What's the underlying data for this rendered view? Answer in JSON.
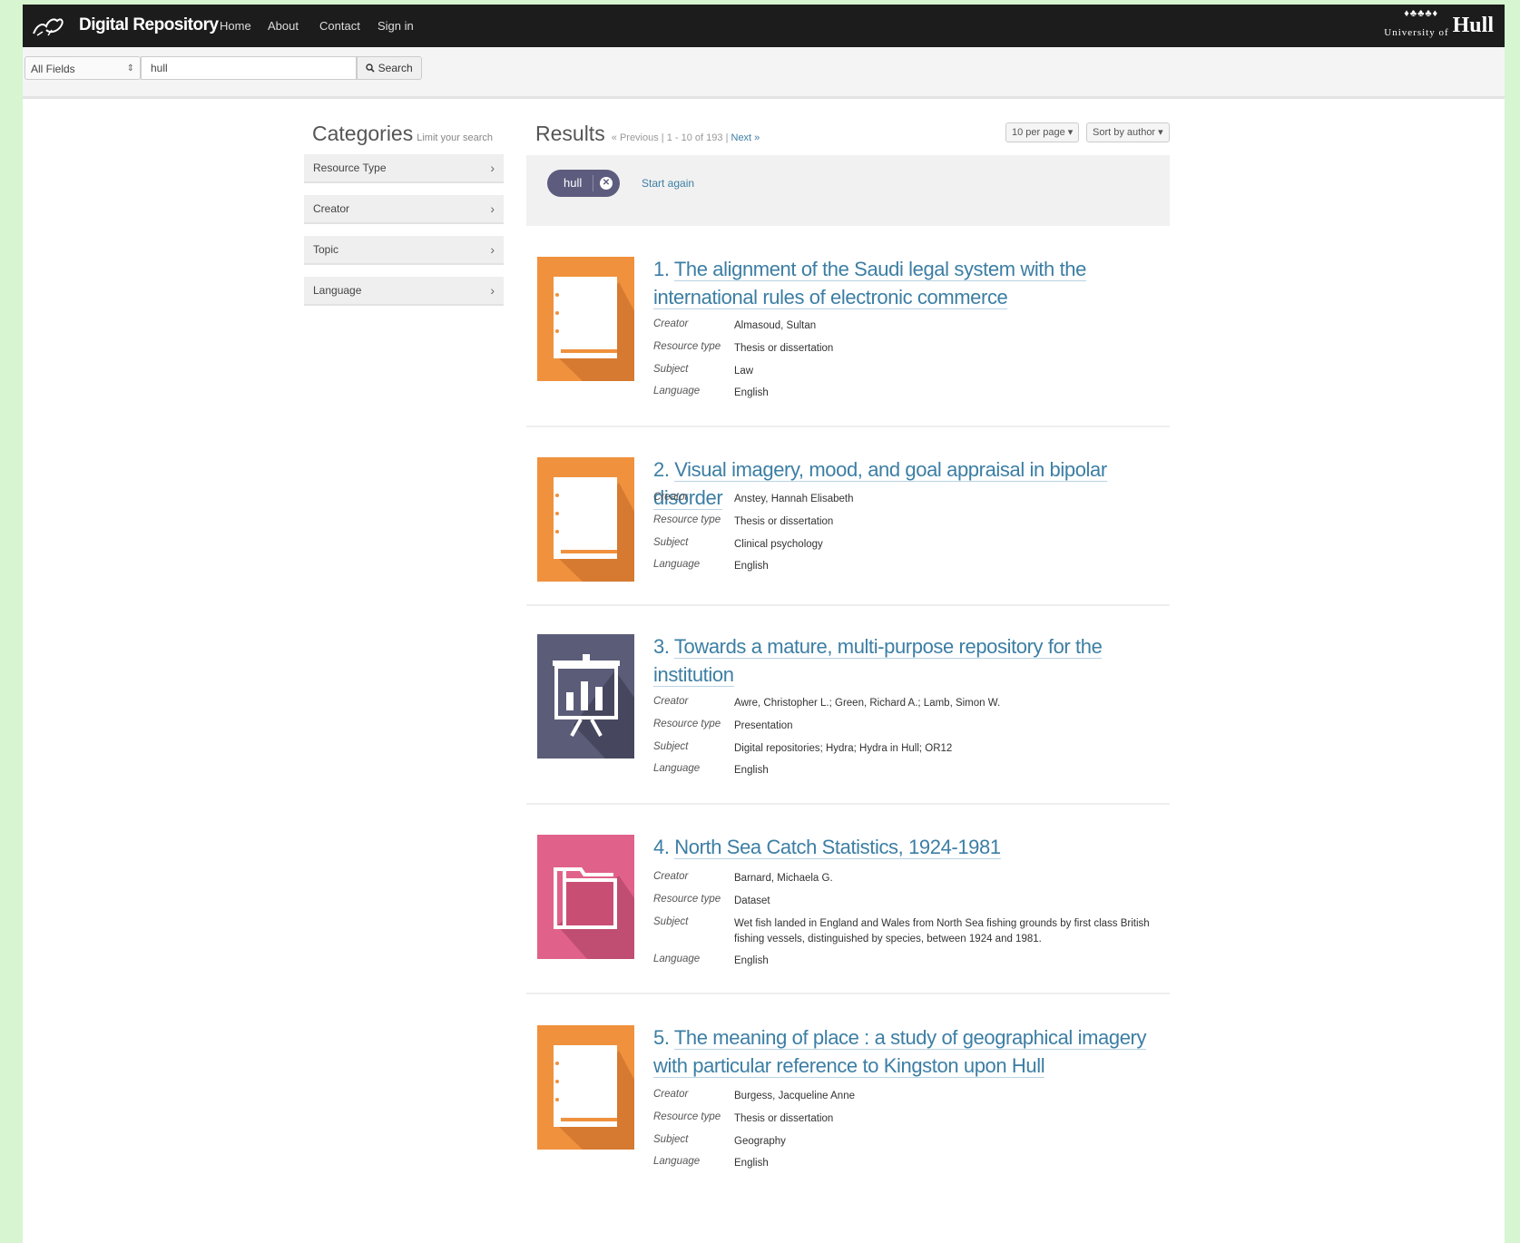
{
  "topbar": {
    "brand_title": "Digital Repository",
    "nav": [
      "Home",
      "About",
      "Contact",
      "Sign in"
    ],
    "university_small": "University of",
    "university_big": "Hull",
    "background_color": "#1c1c1c"
  },
  "search": {
    "field_selected": "All Fields",
    "query": "hull",
    "button_label": "Search",
    "search_icon": "magnifier-icon"
  },
  "sidebar": {
    "heading": "Categories",
    "subheading": "Limit your search",
    "facets": [
      "Resource Type",
      "Creator",
      "Topic",
      "Language"
    ]
  },
  "results_header": {
    "heading": "Results",
    "previous": "« Previous",
    "range": "1 - 10 of 193",
    "next": "Next »",
    "per_page": "10 per page",
    "sort": "Sort by author",
    "filter_value": "hull",
    "start_again": "Start again"
  },
  "field_labels": {
    "creator": "Creator",
    "resource_type": "Resource type",
    "subject": "Subject",
    "language": "Language"
  },
  "results": [
    {
      "number": "1.",
      "title": "The alignment of the Saudi legal system with the international rules of electronic commerce",
      "creator": "Almasoud, Sultan",
      "resource_type": "Thesis or dissertation",
      "subject": "Law",
      "language": "English",
      "icon": "thesis-book-icon",
      "icon_color": "#f0913e"
    },
    {
      "number": "2.",
      "title": "Visual imagery, mood, and goal appraisal in bipolar disorder",
      "creator": "Anstey, Hannah Elisabeth",
      "resource_type": "Thesis or dissertation",
      "subject": "Clinical psychology",
      "language": "English",
      "icon": "thesis-book-icon",
      "icon_color": "#f0913e"
    },
    {
      "number": "3.",
      "title": "Towards a mature, multi-purpose repository for the institution",
      "creator": "Awre, Christopher L.; Green, Richard A.; Lamb, Simon W.",
      "resource_type": "Presentation",
      "subject": "Digital repositories; Hydra; Hydra in Hull; OR12",
      "language": "English",
      "icon": "presentation-chart-icon",
      "icon_color": "#5a5c78"
    },
    {
      "number": "4.",
      "title": "North Sea Catch Statistics, 1924-1981",
      "creator": "Barnard, Michaela G.",
      "resource_type": "Dataset",
      "subject": "Wet fish landed in England and Wales from North Sea fishing grounds by first class British fishing vessels, distinguished by species, between 1924 and 1981.",
      "language": "English",
      "icon": "dataset-folder-icon",
      "icon_color": "#e0628a"
    },
    {
      "number": "5.",
      "title": "The meaning of place : a study of geographical imagery with particular reference to Kingston upon Hull",
      "creator": "Burgess, Jacqueline Anne",
      "resource_type": "Thesis or dissertation",
      "subject": "Geography",
      "language": "English",
      "icon": "thesis-book-icon",
      "icon_color": "#f0913e"
    }
  ]
}
